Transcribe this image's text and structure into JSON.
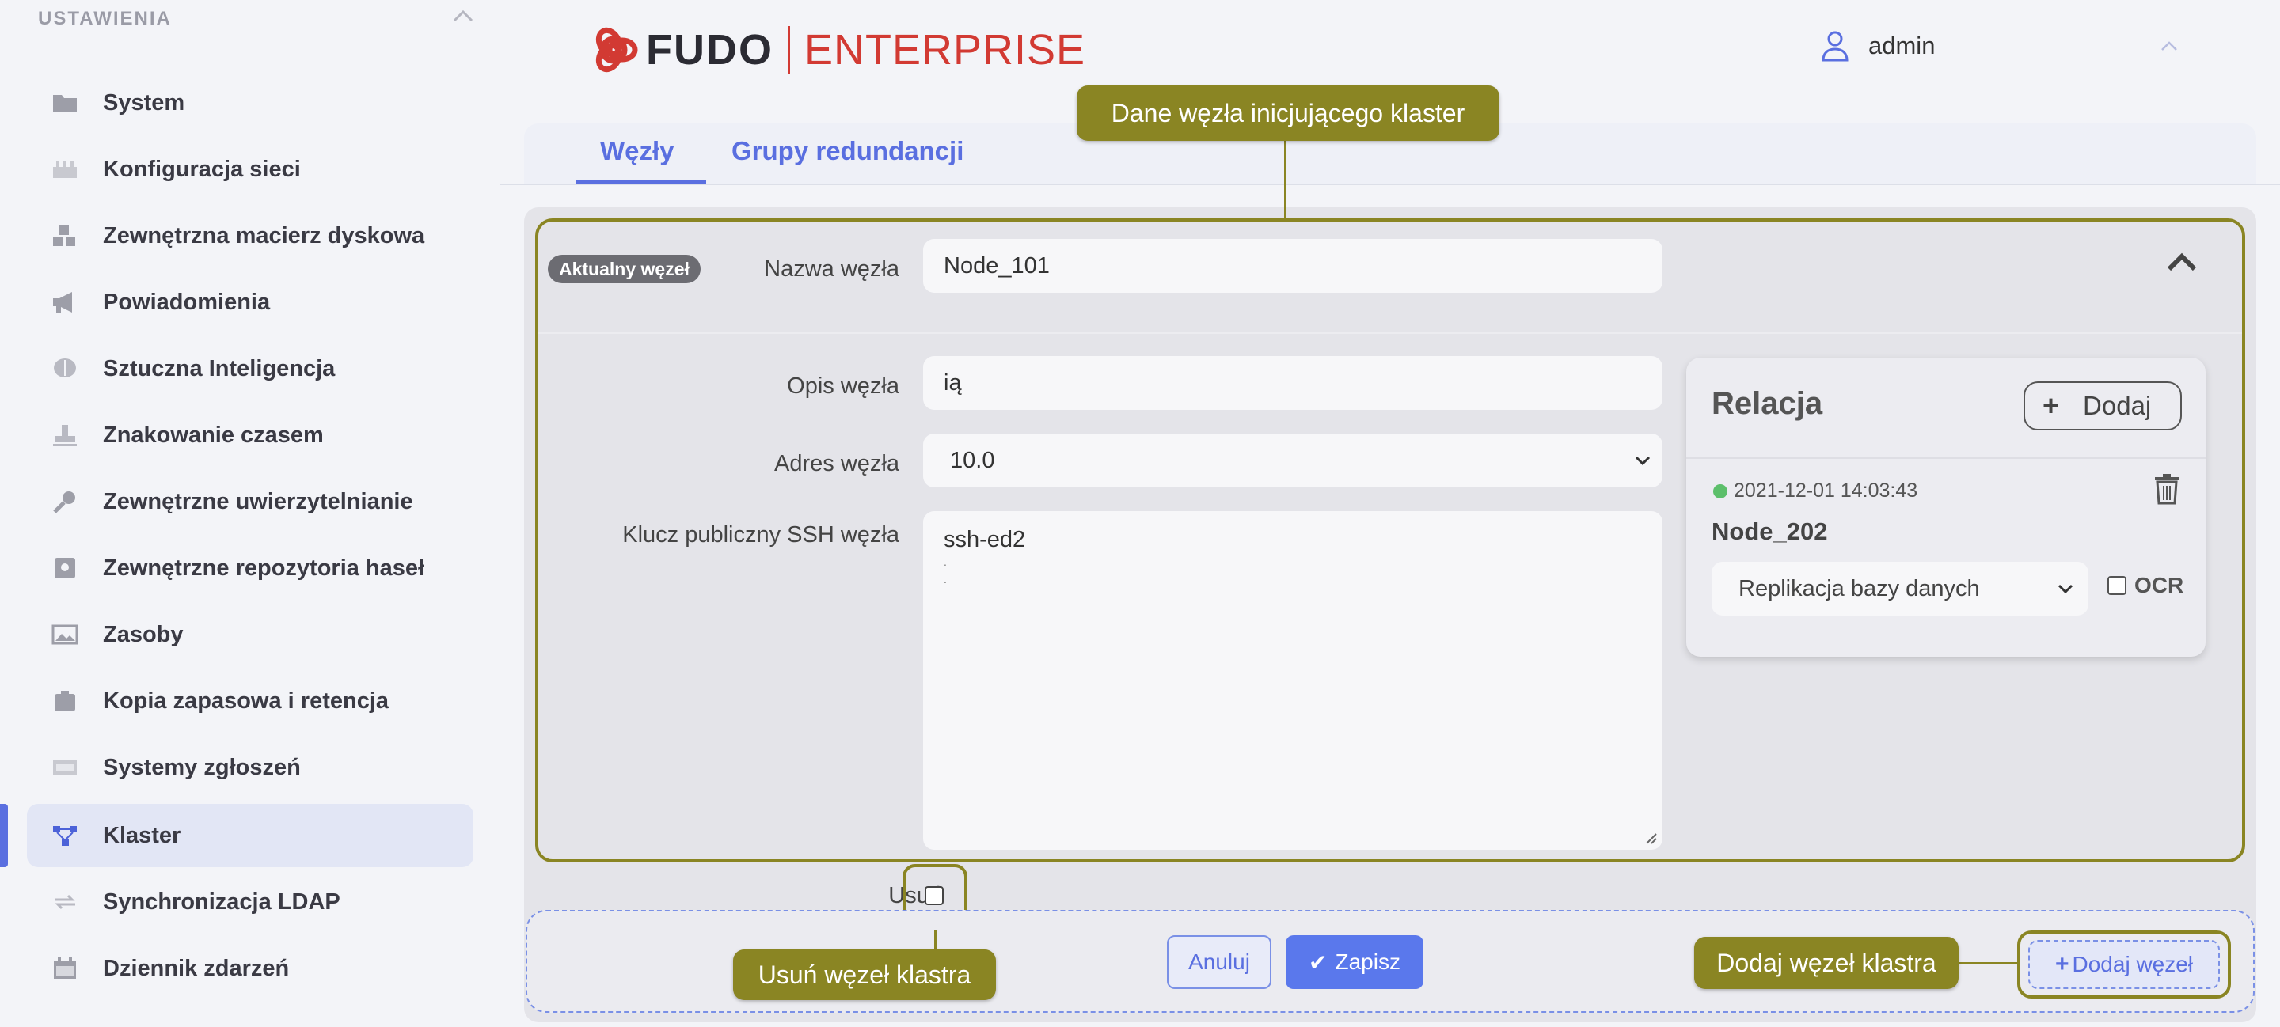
{
  "sidebar": {
    "heading": "USTAWIENIA",
    "items": [
      {
        "label": "System",
        "icon": "folder-icon"
      },
      {
        "label": "Konfiguracja sieci",
        "icon": "network-icon"
      },
      {
        "label": "Zewnętrzna macierz dyskowa",
        "icon": "disk-array-icon"
      },
      {
        "label": "Powiadomienia",
        "icon": "megaphone-icon"
      },
      {
        "label": "Sztuczna Inteligencja",
        "icon": "brain-icon"
      },
      {
        "label": "Znakowanie czasem",
        "icon": "stamp-icon"
      },
      {
        "label": "Zewnętrzne uwierzytelnianie",
        "icon": "key-icon"
      },
      {
        "label": "Zewnętrzne repozytoria haseł",
        "icon": "safe-icon"
      },
      {
        "label": "Zasoby",
        "icon": "image-icon"
      },
      {
        "label": "Kopia zapasowa i retencja",
        "icon": "backup-icon"
      },
      {
        "label": "Systemy zgłoszeń",
        "icon": "ticket-icon"
      },
      {
        "label": "Klaster",
        "icon": "cluster-icon"
      },
      {
        "label": "Synchronizacja LDAP",
        "icon": "sync-icon"
      },
      {
        "label": "Dziennik zdarzeń",
        "icon": "calendar-icon"
      }
    ],
    "active_item": "Klaster"
  },
  "header": {
    "brand_main": "FUDO",
    "brand_sub": "ENTERPRISE",
    "user": "admin"
  },
  "tabs": [
    {
      "label": "Węzły",
      "active": true
    },
    {
      "label": "Grupy redundancji",
      "active": false
    }
  ],
  "node": {
    "badge": "Aktualny węzeł",
    "name_label": "Nazwa węzła",
    "name_value": "Node_101",
    "desc_label": "Opis węzła",
    "desc_value": "ią",
    "address_label": "Adres węzła",
    "address_value": "10.0",
    "ssh_label": "Klucz publiczny SSH węzła",
    "ssh_value": "ssh-ed2"
  },
  "relation": {
    "title": "Relacja",
    "add_label": "Dodaj",
    "timestamp": "2021-12-01 14:03:43",
    "node_name": "Node_202",
    "type_value": "Replikacja bazy danych",
    "ocr_label": "OCR",
    "status_color": "#5cbf6b"
  },
  "delete_label": "Usuń",
  "actions": {
    "cancel": "Anuluj",
    "save": "Zapisz",
    "add_node": "Dodaj węzeł"
  },
  "callouts": {
    "init_node": "Dane węzła inicjującego klaster",
    "delete_node": "Usuń węzeł klastra",
    "add_node": "Dodaj węzeł klastra"
  },
  "colors": {
    "accent": "#5a6fe0",
    "callout": "#8a8523",
    "brand_red": "#d23a33"
  }
}
